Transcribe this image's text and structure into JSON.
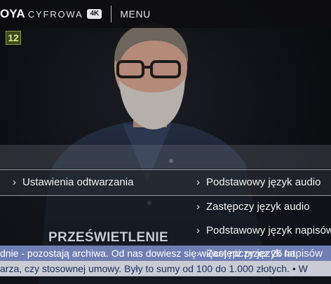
{
  "header": {
    "brand_ya": "OYA",
    "brand_name": "CYFROWA",
    "brand_badge": "4K",
    "menu_label": "MENU"
  },
  "age_rating": "12",
  "playback_menu": {
    "primary": {
      "label": "Ustawienia odtwarzania"
    },
    "submenu": [
      {
        "label": "Podstawowy język audio"
      },
      {
        "label": "Zastępczy język audio"
      },
      {
        "label": "Podstawowy język napisów"
      },
      {
        "label": "Zastępczy język napisów"
      }
    ],
    "chevron": "›"
  },
  "broadcast": {
    "show_title": "PRZEŚWIETLENIE",
    "ticker_line_1": "dnie - pozostają archiwa. Od nas dowiesz się więcej niż przez 25 lat",
    "ticker_line_2": "arza, czy stosownej umowy. Były to sumy od 100 do 1.000 złotych.   •   W"
  },
  "colors": {
    "topbar": "#0e0e10",
    "ticker_blue": "#6f7fb3",
    "ticker_grey": "#c9ccd4",
    "age_badge": "#3e4a1a"
  }
}
